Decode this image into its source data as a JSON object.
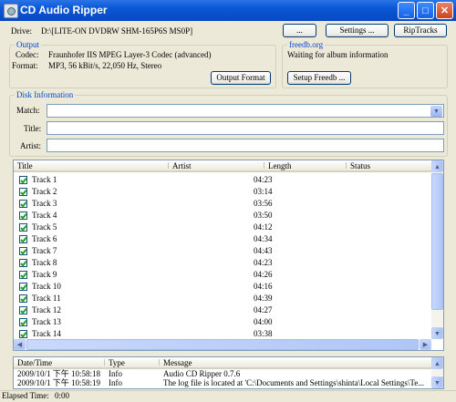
{
  "window": {
    "title": "CD Audio Ripper",
    "controls": {
      "minimize": "_",
      "maximize": "□",
      "close": "✕"
    }
  },
  "toolbar": {
    "drive_label": "Drive:",
    "drive_value": "D:\\[LITE-ON  DVDRW SHM-165P6S MS0P]",
    "browse_label": "...",
    "settings_label": "Settings ...",
    "rip_label": "RipTracks"
  },
  "output": {
    "title": "Output",
    "codec_label": "Codec:",
    "codec_value": "Fraunhofer IIS MPEG Layer-3 Codec (advanced)",
    "format_label": "Format:",
    "format_value": "MP3, 56 kBit/s, 22,050 Hz, Stereo",
    "output_format_button": "Output Format"
  },
  "freedb": {
    "title": "freedb.org",
    "status": "Waiting for album information",
    "setup_button": "Setup Freedb ..."
  },
  "disk": {
    "title": "Disk Information",
    "match_label": "Match:",
    "match_value": "",
    "title_label": "Title:",
    "title_value": "",
    "artist_label": "Artist:",
    "artist_value": ""
  },
  "tracks": {
    "columns": [
      "Title",
      "Artist",
      "Length",
      "Status"
    ],
    "rows": [
      {
        "title": "Track 1",
        "artist": "",
        "length": "04:23",
        "status": ""
      },
      {
        "title": "Track 2",
        "artist": "",
        "length": "03:14",
        "status": ""
      },
      {
        "title": "Track 3",
        "artist": "",
        "length": "03:56",
        "status": ""
      },
      {
        "title": "Track 4",
        "artist": "",
        "length": "03:50",
        "status": ""
      },
      {
        "title": "Track 5",
        "artist": "",
        "length": "04:12",
        "status": ""
      },
      {
        "title": "Track 6",
        "artist": "",
        "length": "04:34",
        "status": ""
      },
      {
        "title": "Track 7",
        "artist": "",
        "length": "04:43",
        "status": ""
      },
      {
        "title": "Track 8",
        "artist": "",
        "length": "04:23",
        "status": ""
      },
      {
        "title": "Track 9",
        "artist": "",
        "length": "04:26",
        "status": ""
      },
      {
        "title": "Track 10",
        "artist": "",
        "length": "04:16",
        "status": ""
      },
      {
        "title": "Track 11",
        "artist": "",
        "length": "04:39",
        "status": ""
      },
      {
        "title": "Track 12",
        "artist": "",
        "length": "04:27",
        "status": ""
      },
      {
        "title": "Track 13",
        "artist": "",
        "length": "04:00",
        "status": ""
      },
      {
        "title": "Track 14",
        "artist": "",
        "length": "03:38",
        "status": ""
      }
    ]
  },
  "log": {
    "columns": [
      "Date/Time",
      "Type",
      "Message"
    ],
    "rows": [
      {
        "datetime": "2009/10/1 下午 10:58:18",
        "type": "Info",
        "message": "Audio CD Ripper 0.7.6"
      },
      {
        "datetime": "2009/10/1 下午 10:58:19",
        "type": "Info",
        "message": "The log file is located at 'C:\\Documents and Settings\\shinta\\Local Settings\\Te..."
      }
    ]
  },
  "status": {
    "elapsed_label": "Elapsed Time:",
    "elapsed_value": "0:00"
  },
  "colors": {
    "titlebar": "#0a58d8",
    "group_title": "#0046d5",
    "background": "#ece9d8",
    "checkmark": "#21a121"
  }
}
